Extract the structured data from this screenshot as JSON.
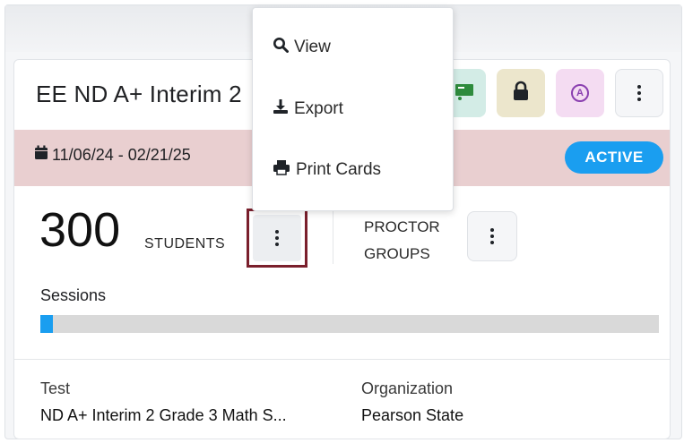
{
  "card": {
    "title": "EE ND A+ Interim 2",
    "date_range": "11/06/24 - 02/21/25",
    "status": "ACTIVE"
  },
  "toolbar": {
    "icons": [
      "presentation-icon",
      "lock-icon",
      "assessment-icon",
      "more-vertical-icon"
    ],
    "assessment_glyph": "A"
  },
  "stats": {
    "student_count": "300",
    "students_label": "STUDENTS",
    "proctor_label_line1": "PROCTOR",
    "proctor_label_line2": "GROUPS"
  },
  "sessions": {
    "label": "Sessions",
    "progress_fraction": 0.02
  },
  "details": {
    "test_label": "Test",
    "test_value": "ND A+ Interim 2 Grade 3 Math S...",
    "org_label": "Organization",
    "org_value": "Pearson State"
  },
  "menu": {
    "items": [
      {
        "label": "View",
        "icon": "search-icon"
      },
      {
        "label": "Export",
        "icon": "download-icon"
      },
      {
        "label": "Print Cards",
        "icon": "print-icon"
      }
    ]
  },
  "colors": {
    "accent": "#1a9ef0",
    "date_band": "#e9cfd0",
    "highlight_border": "#7a1f2c"
  }
}
